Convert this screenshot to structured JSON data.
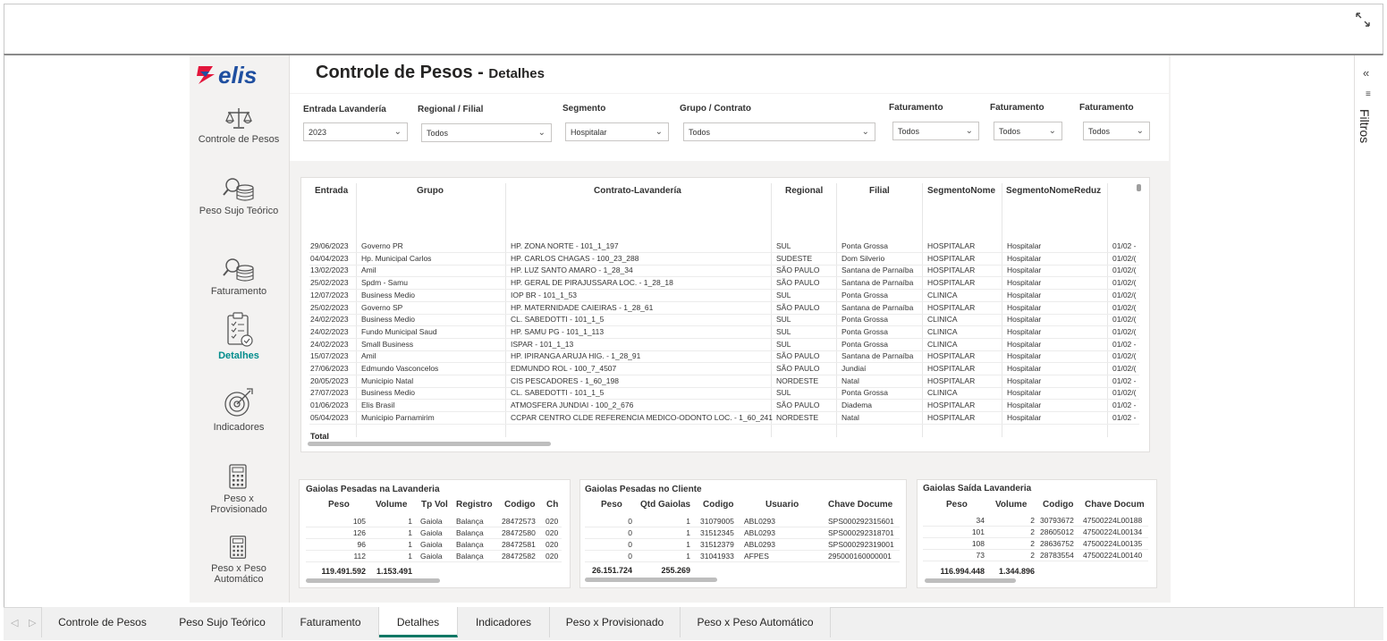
{
  "report": {
    "title": "Controle de Pesos",
    "title_sep": "-",
    "subtitle": "Detalhes"
  },
  "brand": {
    "name": "elis",
    "accent": "#e3163c",
    "blue": "#1f4fa0",
    "teal": "#008c8c"
  },
  "nav": [
    {
      "label": "Controle de Pesos",
      "icon": "scale-icon",
      "active": false
    },
    {
      "label": "Peso Sujo Teórico",
      "icon": "coins-search-icon",
      "active": false
    },
    {
      "label": "Faturamento",
      "icon": "coins-search-icon",
      "active": false
    },
    {
      "label": "Detalhes",
      "icon": "clipboard-checklist-icon",
      "active": true
    },
    {
      "label": "Indicadores",
      "icon": "target-icon",
      "active": false
    },
    {
      "label": "Peso x Provisionado",
      "icon": "calculator-icon",
      "active": false
    },
    {
      "label": "Peso x Peso Automático",
      "icon": "calculator-icon",
      "active": false
    }
  ],
  "filters": [
    {
      "label": "Entrada Lavandería",
      "value": "2023"
    },
    {
      "label": "Regional / Filial",
      "value": "Todos"
    },
    {
      "label": "Segmento",
      "value": "Hospitalar"
    },
    {
      "label": "Grupo / Contrato",
      "value": "Todos"
    },
    {
      "label": "Faturamento",
      "value": "Todos"
    },
    {
      "label": "Faturamento",
      "value": "Todos"
    },
    {
      "label": "Faturamento",
      "value": "Todos"
    }
  ],
  "main_table": {
    "columns": [
      "Entrada",
      "Grupo",
      "Contrato-Lavandería",
      "Regional",
      "Filial",
      "SegmentoNome",
      "SegmentoNomeReduz"
    ],
    "rows": [
      [
        "29/06/2023",
        "Governo PR",
        "HP. ZONA NORTE - 101_1_197",
        "SUL",
        "Ponta Grossa",
        "HOSPITALAR",
        "Hospitalar",
        "01/02 -"
      ],
      [
        "04/04/2023",
        "Hp. Municipal Carlos",
        "HP. CARLOS CHAGAS - 100_23_288",
        "SUDESTE",
        "Dom Silverio",
        "HOSPITALAR",
        "Hospitalar",
        "01/02/("
      ],
      [
        "13/02/2023",
        "Amil",
        "HP. LUZ SANTO AMARO - 1_28_34",
        "SÃO PAULO",
        "Santana de Parnaíba",
        "HOSPITALAR",
        "Hospitalar",
        "01/02/("
      ],
      [
        "25/02/2023",
        "Spdm - Samu",
        "HP. GERAL DE PIRAJUSSARA LOC. - 1_28_18",
        "SÃO PAULO",
        "Santana de Parnaíba",
        "HOSPITALAR",
        "Hospitalar",
        "01/02/("
      ],
      [
        "12/07/2023",
        "Business Medio",
        "IOP BR - 101_1_53",
        "SUL",
        "Ponta Grossa",
        "CLINICA",
        "Hospitalar",
        "01/02/("
      ],
      [
        "25/02/2023",
        "Governo SP",
        "HP. MATERNIDADE CAIEIRAS - 1_28_61",
        "SÃO PAULO",
        "Santana de Parnaíba",
        "HOSPITALAR",
        "Hospitalar",
        "01/02/("
      ],
      [
        "24/02/2023",
        "Business Medio",
        "CL. SABEDOTTI - 101_1_5",
        "SUL",
        "Ponta Grossa",
        "CLINICA",
        "Hospitalar",
        "01/02/("
      ],
      [
        "24/02/2023",
        "Fundo Municipal Saud",
        "HP. SAMU PG - 101_1_113",
        "SUL",
        "Ponta Grossa",
        "CLINICA",
        "Hospitalar",
        "01/02/("
      ],
      [
        "24/02/2023",
        "Small Business",
        "ISPAR - 101_1_13",
        "SUL",
        "Ponta Grossa",
        "CLINICA",
        "Hospitalar",
        "01/02 -"
      ],
      [
        "15/07/2023",
        "Amil",
        "HP. IPIRANGA ARUJA HIG. - 1_28_91",
        "SÃO PAULO",
        "Santana de Parnaíba",
        "HOSPITALAR",
        "Hospitalar",
        "01/02/("
      ],
      [
        "27/06/2023",
        "Edmundo Vasconcelos",
        "EDMUNDO ROL - 100_7_4507",
        "SÃO PAULO",
        "Jundiaí",
        "HOSPITALAR",
        "Hospitalar",
        "01/02/("
      ],
      [
        "20/05/2023",
        "Municipio Natal",
        "CIS PESCADORES - 1_60_198",
        "NORDESTE",
        "Natal",
        "HOSPITALAR",
        "Hospitalar",
        "01/02 -"
      ],
      [
        "27/07/2023",
        "Business Medio",
        "CL. SABEDOTTI - 101_1_5",
        "SUL",
        "Ponta Grossa",
        "CLINICA",
        "Hospitalar",
        "01/02/("
      ],
      [
        "01/06/2023",
        "Elis Brasil",
        "ATMOSFERA JUNDIAI - 100_2_676",
        "SÃO PAULO",
        "Diadema",
        "HOSPITALAR",
        "Hospitalar",
        "01/02 -"
      ],
      [
        "05/04/2023",
        "Municipio Parnamirim",
        "CCPAR CENTRO CLDE REFERENCIA MEDICO-ODONTO LOC. - 1_60_241",
        "NORDESTE",
        "Natal",
        "HOSPITALAR",
        "Hospitalar",
        "01/02 -"
      ]
    ],
    "total_label": "Total"
  },
  "card_lavanderia": {
    "title": "Gaiolas Pesadas na Lavanderia",
    "columns": [
      "Peso",
      "Volume",
      "Tp Vol",
      "Registro",
      "Codigo",
      "Ch"
    ],
    "rows": [
      [
        "105",
        "1",
        "Gaiola",
        "Balança",
        "28472573",
        "020"
      ],
      [
        "126",
        "1",
        "Gaiola",
        "Balança",
        "28472580",
        "020"
      ],
      [
        "96",
        "1",
        "Gaiola",
        "Balança",
        "28472581",
        "020"
      ],
      [
        "112",
        "1",
        "Gaiola",
        "Balança",
        "28472582",
        "020"
      ]
    ],
    "totals": [
      "119.491.592",
      "1.153.491"
    ]
  },
  "card_cliente": {
    "title": "Gaiolas Pesadas no Cliente",
    "columns": [
      "Peso",
      "Qtd Gaiolas",
      "Codigo",
      "Usuario",
      "Chave Docume"
    ],
    "rows": [
      [
        "0",
        "1",
        "31079005",
        "ABL0293",
        "SPS000292315601"
      ],
      [
        "0",
        "1",
        "31512345",
        "ABL0293",
        "SPS000292318701"
      ],
      [
        "0",
        "1",
        "31512379",
        "ABL0293",
        "SPS000292319001"
      ],
      [
        "0",
        "1",
        "31041933",
        "AFPES",
        "295000160000001"
      ]
    ],
    "totals": [
      "26.151.724",
      "255.269"
    ]
  },
  "card_saida": {
    "title": "Gaiolas Saída Lavanderia",
    "columns": [
      "Peso",
      "Volume",
      "Codigo",
      "Chave Docum"
    ],
    "rows": [
      [
        "34",
        "2",
        "30793672",
        "47500224L00188"
      ],
      [
        "101",
        "2",
        "28605012",
        "47500224L00134"
      ],
      [
        "108",
        "2",
        "28636752",
        "47500224L00135"
      ],
      [
        "73",
        "2",
        "28783554",
        "47500224L00140"
      ]
    ],
    "totals": [
      "116.994.448",
      "1.344.896"
    ]
  },
  "filters_pane": {
    "label": "Filtros"
  },
  "tabs": [
    {
      "label": "Controle de Pesos",
      "active": false
    },
    {
      "label": "Peso Sujo Teórico",
      "active": false
    },
    {
      "label": "Faturamento",
      "active": false
    },
    {
      "label": "Detalhes",
      "active": true
    },
    {
      "label": "Indicadores",
      "active": false
    },
    {
      "label": "Peso x Provisionado",
      "active": false
    },
    {
      "label": "Peso x Peso Automático",
      "active": false
    }
  ]
}
